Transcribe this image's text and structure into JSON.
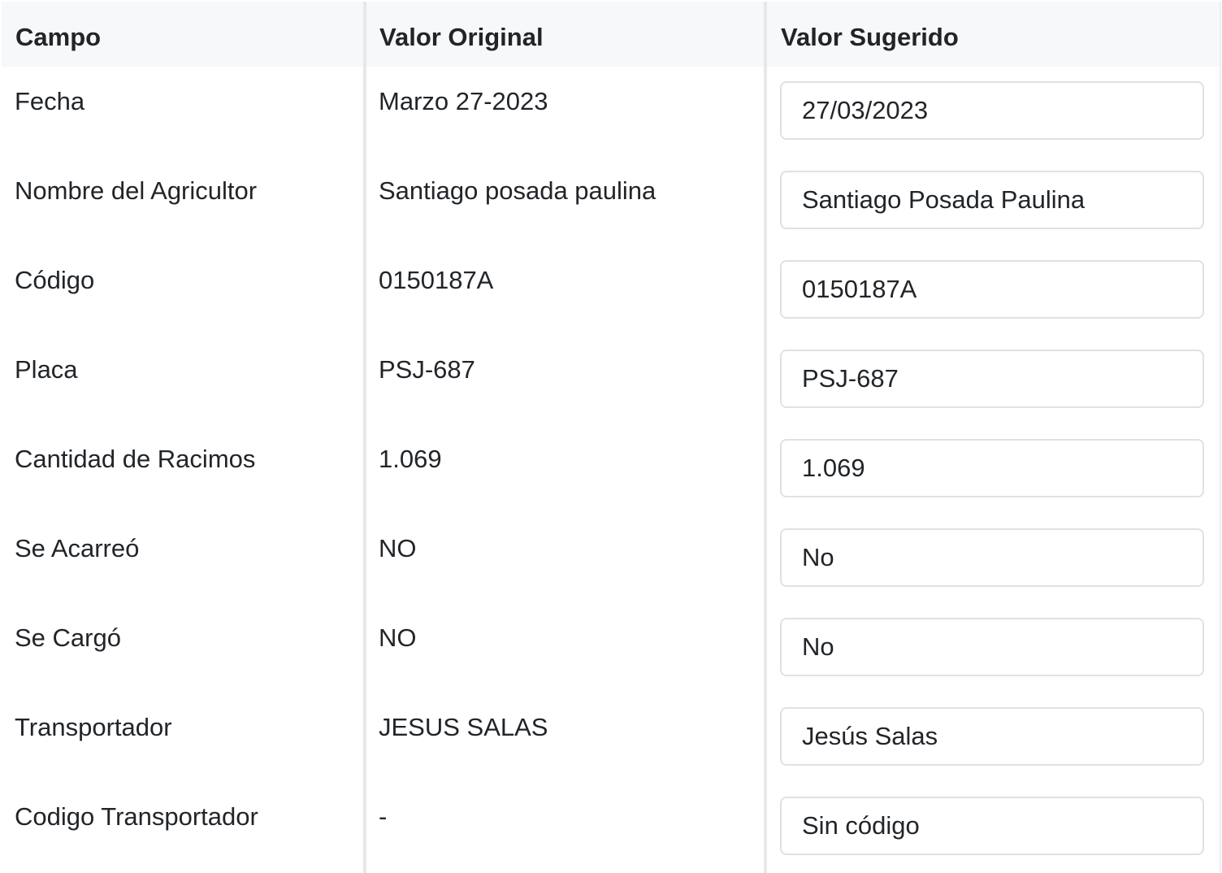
{
  "table": {
    "headers": {
      "field": "Campo",
      "original": "Valor Original",
      "suggested": "Valor Sugerido"
    },
    "rows": [
      {
        "field": "Fecha",
        "original": "Marzo 27-2023",
        "suggested": "27/03/2023"
      },
      {
        "field": "Nombre del Agricultor",
        "original": "Santiago posada paulina",
        "suggested": "Santiago Posada Paulina"
      },
      {
        "field": "Código",
        "original": "0150187A",
        "suggested": "0150187A"
      },
      {
        "field": "Placa",
        "original": "PSJ-687",
        "suggested": "PSJ-687"
      },
      {
        "field": "Cantidad de Racimos",
        "original": "1.069",
        "suggested": "1.069"
      },
      {
        "field": "Se Acarreó",
        "original": "NO",
        "suggested": "No"
      },
      {
        "field": "Se Cargó",
        "original": "NO",
        "suggested": "No"
      },
      {
        "field": "Transportador",
        "original": "JESUS SALAS",
        "suggested": "Jesús Salas"
      },
      {
        "field": "Codigo Transportador",
        "original": "-",
        "suggested": "Sin código"
      }
    ]
  }
}
